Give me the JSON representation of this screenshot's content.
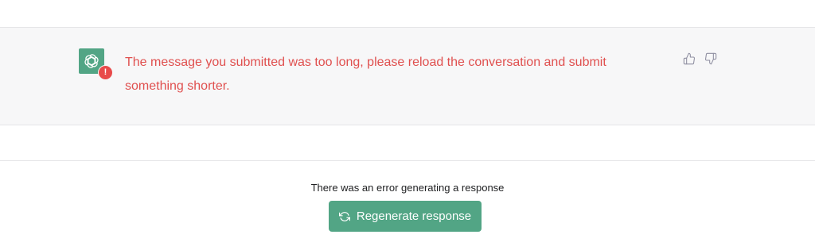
{
  "message": {
    "avatar_icon": "openai-logo-icon",
    "badge_text": "!",
    "error_text": "The message you submitted was too long, please reload the conversation and submit something shorter.",
    "feedback": {
      "thumbs_up_icon": "thumbs-up-icon",
      "thumbs_down_icon": "thumbs-down-icon"
    }
  },
  "footer": {
    "error_status": "There was an error generating a response",
    "regenerate_label": "Regenerate response",
    "regenerate_icon": "refresh-icon"
  },
  "colors": {
    "accent": "#52a585",
    "error": "#e0504f",
    "badge": "#e84a4a",
    "row_background": "#f7f7f8"
  }
}
